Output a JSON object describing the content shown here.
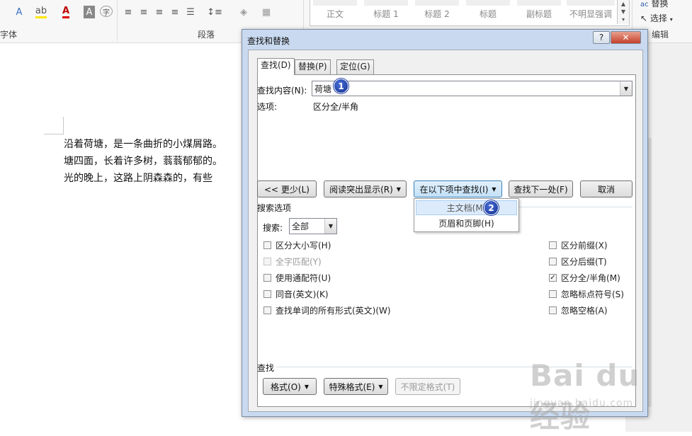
{
  "ribbon": {
    "font_group_label": "字体",
    "paragraph_group_label": "段落",
    "editing_group_label": "编辑",
    "replace_label": "替换",
    "select_label": "选择",
    "styles": [
      "正文",
      "标题 1",
      "标题 2",
      "标题",
      "副标题",
      "不明显强调"
    ]
  },
  "document": {
    "lines": [
      "沿着荷塘，是一条曲折的小煤屑路。",
      "塘四面，长着许多树，蓊蓊郁郁的。",
      "光的晚上，这路上阴森森的，有些"
    ]
  },
  "dialog": {
    "title": "查找和替换",
    "help_label": "?",
    "close_label": "✕",
    "tabs": [
      "查找(D)",
      "替换(P)",
      "定位(G)"
    ],
    "find_label": "查找内容(N):",
    "find_value": "荷塘",
    "options_label": "选项:",
    "options_value": "区分全/半角",
    "buttons": {
      "less": "<< 更少(L)",
      "reading_highlight": "阅读突出显示(R)",
      "find_in": "在以下项中查找(I)",
      "find_next": "查找下一处(F)",
      "cancel": "取消"
    },
    "find_in_menu": [
      "主文档(M)",
      "页眉和页脚(H)"
    ],
    "search_options_label": "搜索选项",
    "search_label": "搜索:",
    "search_value": "全部",
    "checkboxes_left": [
      {
        "label": "区分大小写(H)",
        "checked": false,
        "enabled": true
      },
      {
        "label": "全字匹配(Y)",
        "checked": false,
        "enabled": false
      },
      {
        "label": "使用通配符(U)",
        "checked": false,
        "enabled": true
      },
      {
        "label": "同音(英文)(K)",
        "checked": false,
        "enabled": true
      },
      {
        "label": "查找单词的所有形式(英文)(W)",
        "checked": false,
        "enabled": true
      }
    ],
    "checkboxes_right": [
      {
        "label": "区分前缀(X)",
        "checked": false,
        "enabled": true
      },
      {
        "label": "区分后缀(T)",
        "checked": false,
        "enabled": true
      },
      {
        "label": "区分全/半角(M)",
        "checked": true,
        "enabled": true
      },
      {
        "label": "忽略标点符号(S)",
        "checked": false,
        "enabled": true
      },
      {
        "label": "忽略空格(A)",
        "checked": false,
        "enabled": true
      }
    ],
    "find_section_label": "查找",
    "format_button": "格式(O)",
    "special_button": "特殊格式(E)",
    "no_format_button": "不限定格式(T)"
  },
  "annotations": {
    "badge1": "1",
    "badge2": "2"
  },
  "watermark": {
    "main": "Bai du 经验",
    "sub": "jingyan.baidu.com"
  }
}
